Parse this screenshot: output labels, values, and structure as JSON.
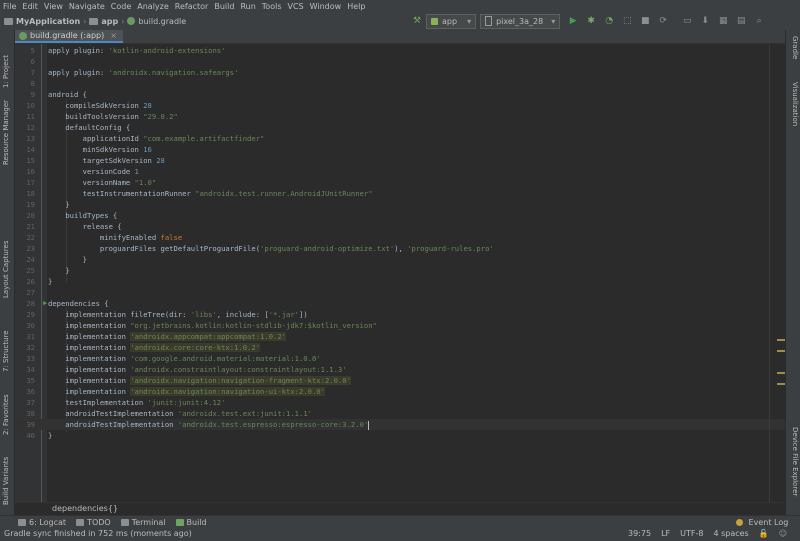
{
  "menu": [
    "File",
    "Edit",
    "View",
    "Navigate",
    "Code",
    "Analyze",
    "Refactor",
    "Build",
    "Run",
    "Tools",
    "VCS",
    "Window",
    "Help"
  ],
  "breadcrumbs": [
    "MyApplication",
    "app",
    "build.gradle"
  ],
  "toolbar": {
    "run_config": "app",
    "device": "pixel_3a_28"
  },
  "left_tool_windows": [
    "1: Project",
    "Resource Manager",
    "Layout Captures",
    "7: Structure",
    "2: Favorites",
    "Build Variants"
  ],
  "right_tool_windows": [
    "Gradle",
    "Visualization",
    "Device File Explorer"
  ],
  "editor_tab": {
    "label": "build.gradle (:app)"
  },
  "code_lines": [
    {
      "n": "5",
      "t": "apply plugin: 'kotlin-android-extensions'"
    },
    {
      "n": "6",
      "t": ""
    },
    {
      "n": "7",
      "t": "apply plugin: 'androidx.navigation.safeargs'"
    },
    {
      "n": "8",
      "t": ""
    },
    {
      "n": "9",
      "t": "android {"
    },
    {
      "n": "10",
      "t": "    compileSdkVersion 28"
    },
    {
      "n": "11",
      "t": "    buildToolsVersion \"29.0.2\""
    },
    {
      "n": "12",
      "t": "    defaultConfig {"
    },
    {
      "n": "13",
      "t": "        applicationId \"com.example.artifactfinder\""
    },
    {
      "n": "14",
      "t": "        minSdkVersion 16"
    },
    {
      "n": "15",
      "t": "        targetSdkVersion 28"
    },
    {
      "n": "16",
      "t": "        versionCode 1"
    },
    {
      "n": "17",
      "t": "        versionName \"1.0\""
    },
    {
      "n": "18",
      "t": "        testInstrumentationRunner \"androidx.test.runner.AndroidJUnitRunner\""
    },
    {
      "n": "19",
      "t": "    }"
    },
    {
      "n": "20",
      "t": "    buildTypes {"
    },
    {
      "n": "21",
      "t": "        release {"
    },
    {
      "n": "22",
      "t": "            minifyEnabled false"
    },
    {
      "n": "23",
      "t": "            proguardFiles getDefaultProguardFile('proguard-android-optimize.txt'), 'proguard-rules.pro'"
    },
    {
      "n": "24",
      "t": "        }"
    },
    {
      "n": "25",
      "t": "    }"
    },
    {
      "n": "26",
      "t": "}"
    },
    {
      "n": "27",
      "t": ""
    },
    {
      "n": "28",
      "t": "dependencies {"
    },
    {
      "n": "29",
      "t": "    implementation fileTree(dir: 'libs', include: ['*.jar'])"
    },
    {
      "n": "30",
      "t": "    implementation \"org.jetbrains.kotlin:kotlin-stdlib-jdk7:$kotlin_version\""
    },
    {
      "n": "31",
      "t": "    implementation 'androidx.appcompat:appcompat:1.0.2'"
    },
    {
      "n": "32",
      "t": "    implementation 'androidx.core:core-ktx:1.0.2'"
    },
    {
      "n": "33",
      "t": "    implementation 'com.google.android.material:material:1.0.0'"
    },
    {
      "n": "34",
      "t": "    implementation 'androidx.constraintlayout:constraintlayout:1.1.3'"
    },
    {
      "n": "35",
      "t": "    implementation 'androidx.navigation:navigation-fragment-ktx:2.0.0'"
    },
    {
      "n": "36",
      "t": "    implementation 'androidx.navigation:navigation-ui-ktx:2.0.0'"
    },
    {
      "n": "37",
      "t": "    testImplementation 'junit:junit:4.12'"
    },
    {
      "n": "38",
      "t": "    androidTestImplementation 'androidx.test.ext:junit:1.1.1'"
    },
    {
      "n": "39",
      "t": "    androidTestImplementation 'androidx.test.espresso:espresso-core:3.2.0'"
    },
    {
      "n": "40",
      "t": "}"
    }
  ],
  "editor_breadcrumb": "dependencies{}",
  "bottom_tools": [
    "6: Logcat",
    "TODO",
    "Terminal",
    "Build"
  ],
  "event_log": "Event Log",
  "status": {
    "message": "Gradle sync finished in 752 ms (moments ago)",
    "position": "39:75",
    "line_sep": "LF",
    "encoding": "UTF-8",
    "indent": "4 spaces"
  },
  "colors": {
    "string": "#6a8759",
    "number": "#6897bb",
    "keyword": "#cc7832",
    "run": "#499c54",
    "warning": "#a08c45"
  }
}
